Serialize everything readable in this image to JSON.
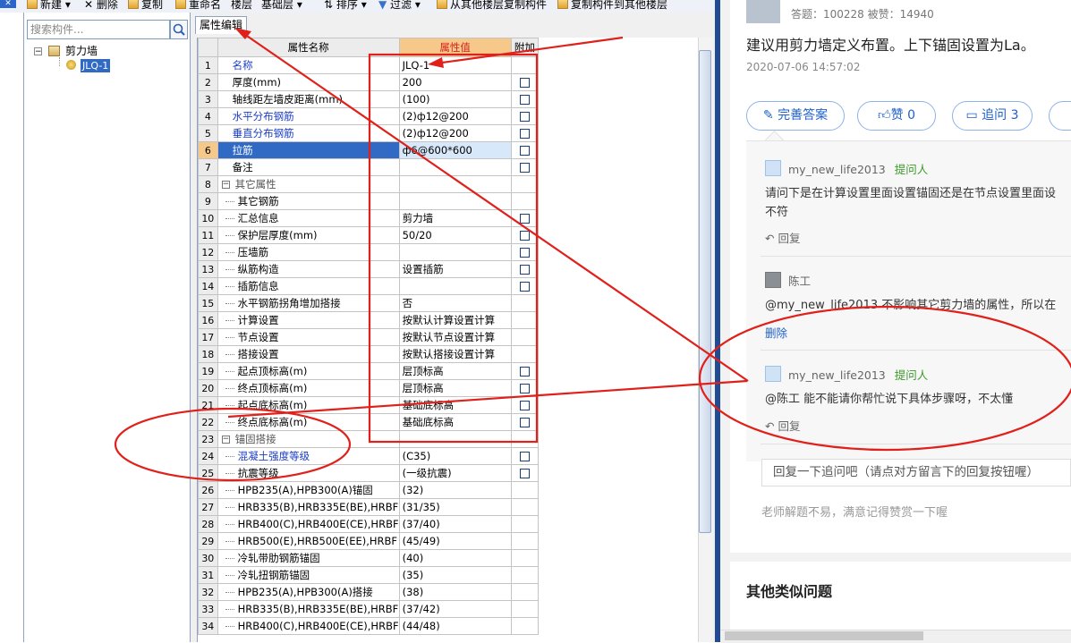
{
  "toolbar": {
    "new_label": "新建",
    "delete_label": "删除",
    "copy_label": "复制",
    "rename_label": "重命名",
    "floor_label": "楼层",
    "floor_value": "基础层",
    "sort_label": "排序",
    "filter_label": "过滤",
    "copy_from_floors": "从其他楼层复制构件",
    "copy_to_floors": "复制构件到其他楼层"
  },
  "tree": {
    "search_placeholder": "搜索构件...",
    "root_label": "剪力墙",
    "child_label": "JLQ-1"
  },
  "editor": {
    "tab_label": "属性编辑",
    "col_name": "属性名称",
    "col_value": "属性值",
    "col_extra": "附加",
    "rows": [
      {
        "num": "1",
        "name": "名称",
        "value": "JLQ-1",
        "checkbox": false
      },
      {
        "num": "2",
        "name": "厚度(mm)",
        "value": "200",
        "checkbox": true
      },
      {
        "num": "3",
        "name": "轴线距左墙皮距离(mm)",
        "value": "(100)",
        "checkbox": true
      },
      {
        "num": "4",
        "name": "水平分布钢筋",
        "value": "(2)ф12@200",
        "checkbox": true
      },
      {
        "num": "5",
        "name": "垂直分布钢筋",
        "value": "(2)ф12@200",
        "checkbox": true
      },
      {
        "num": "6",
        "name": "拉筋",
        "value": "ф6@600*600",
        "checkbox": true
      },
      {
        "num": "7",
        "name": "备注",
        "value": "",
        "checkbox": true
      },
      {
        "num": "8",
        "name": "其它属性",
        "value": "",
        "checkbox": false
      },
      {
        "num": "9",
        "name": "其它钢筋",
        "value": "",
        "checkbox": false
      },
      {
        "num": "10",
        "name": "汇总信息",
        "value": "剪力墙",
        "checkbox": true
      },
      {
        "num": "11",
        "name": "保护层厚度(mm)",
        "value": "50/20",
        "checkbox": true
      },
      {
        "num": "12",
        "name": "压墙筋",
        "value": "",
        "checkbox": true
      },
      {
        "num": "13",
        "name": "纵筋构造",
        "value": "设置插筋",
        "checkbox": true
      },
      {
        "num": "14",
        "name": "插筋信息",
        "value": "",
        "checkbox": true
      },
      {
        "num": "15",
        "name": "水平钢筋拐角增加搭接",
        "value": "否",
        "checkbox": false
      },
      {
        "num": "16",
        "name": "计算设置",
        "value": "按默认计算设置计算",
        "checkbox": false
      },
      {
        "num": "17",
        "name": "节点设置",
        "value": "按默认节点设置计算",
        "checkbox": false
      },
      {
        "num": "18",
        "name": "搭接设置",
        "value": "按默认搭接设置计算",
        "checkbox": false
      },
      {
        "num": "19",
        "name": "起点顶标高(m)",
        "value": "层顶标高",
        "checkbox": true
      },
      {
        "num": "20",
        "name": "终点顶标高(m)",
        "value": "层顶标高",
        "checkbox": true
      },
      {
        "num": "21",
        "name": "起点底标高(m)",
        "value": "基础底标高",
        "checkbox": true
      },
      {
        "num": "22",
        "name": "终点底标高(m)",
        "value": "基础底标高",
        "checkbox": true
      },
      {
        "num": "23",
        "name": "锚固搭接",
        "value": "",
        "checkbox": false
      },
      {
        "num": "24",
        "name": "混凝土强度等级",
        "value": "(C35)",
        "checkbox": true
      },
      {
        "num": "25",
        "name": "抗震等级",
        "value": "(一级抗震)",
        "checkbox": true
      },
      {
        "num": "26",
        "name": "HPB235(A),HPB300(A)锚固",
        "value": "(32)",
        "checkbox": false
      },
      {
        "num": "27",
        "name": "HRB335(B),HRB335E(BE),HRBF",
        "value": "(31/35)",
        "checkbox": false
      },
      {
        "num": "28",
        "name": "HRB400(C),HRB400E(CE),HRBF",
        "value": "(37/40)",
        "checkbox": false
      },
      {
        "num": "29",
        "name": "HRB500(E),HRB500E(EE),HRBF",
        "value": "(45/49)",
        "checkbox": false
      },
      {
        "num": "30",
        "name": "冷轧带肋钢筋锚固",
        "value": "(40)",
        "checkbox": false
      },
      {
        "num": "31",
        "name": "冷轧扭钢筋锚固",
        "value": "(35)",
        "checkbox": false
      },
      {
        "num": "32",
        "name": "HPB235(A),HPB300(A)搭接",
        "value": "(38)",
        "checkbox": false
      },
      {
        "num": "33",
        "name": "HRB335(B),HRB335E(BE),HRBF",
        "value": "(37/42)",
        "checkbox": false
      },
      {
        "num": "34",
        "name": "HRB400(C),HRB400E(CE),HRBF",
        "value": "(44/48)",
        "checkbox": false
      }
    ]
  },
  "web": {
    "stats": "答题：100228    被赞：14940",
    "answer": "建议用剪力墙定义布置。上下锚固设置为La。",
    "timestamp": "2020-07-06 14:57:02",
    "improve_btn": "完善答案",
    "like_btn": "赞 0",
    "followup_btn": "追问 3",
    "comments": [
      {
        "user": "my_new_life2013",
        "tag": "提问人",
        "text1": "请问下是在计算设置里面设置锚固还是在节点设置里面设",
        "text2": "不符",
        "action": "回复"
      },
      {
        "user": "陈工",
        "tag": "",
        "text1": "@my_new_life2013 不影响其它剪力墙的属性，所以在",
        "text2": "",
        "action": "删除"
      },
      {
        "user": "my_new_life2013",
        "tag": "提问人",
        "text1": "@陈工 能不能请你帮忙说下具体步骤呀，不太懂",
        "text2": "",
        "action": "回复"
      }
    ],
    "reply_placeholder": "回复一下追问吧（请点对方留言下的回复按钮喔）",
    "note": "老师解题不易，满意记得赞赏一下喔",
    "other_title": "其他类似问题"
  },
  "colors": {
    "annotation_red": "#e0201a",
    "link_blue": "#1f5fc9",
    "asker_green": "#3c9a2c",
    "selection_blue": "#316ac5"
  }
}
